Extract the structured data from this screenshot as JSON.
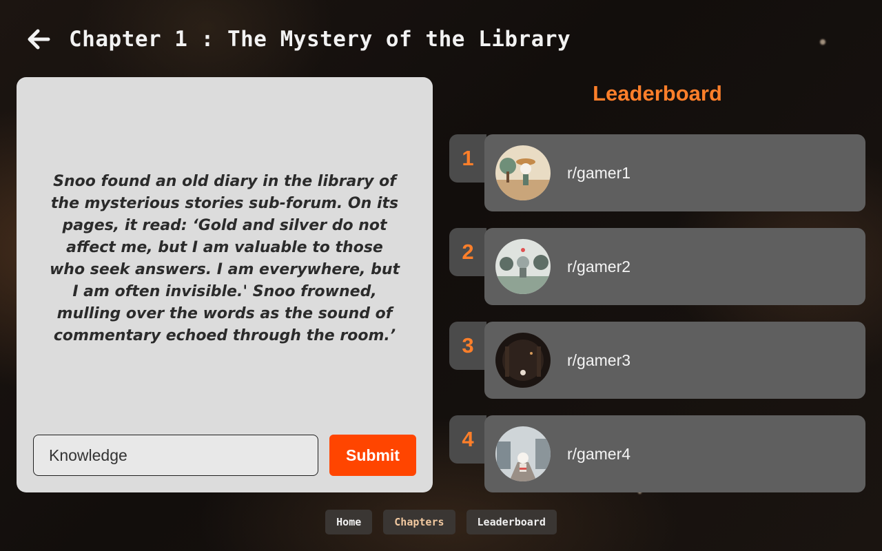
{
  "header": {
    "title": "Chapter 1 : The Mystery of the Library",
    "back_icon": "arrow-left-icon"
  },
  "story": {
    "text": "Snoo found an old diary in the library of the mysterious stories sub-forum. On its pages, it read: ‘Gold and silver do not affect me, but I am valuable to those who seek answers. I am everywhere, but I am often invisible.' Snoo frowned, mulling over the words as the sound of commentary echoed through the room.’",
    "answer_value": "Knowledge",
    "submit_label": "Submit"
  },
  "leaderboard": {
    "title": "Leaderboard",
    "entries": [
      {
        "rank": "1",
        "name": "r/gamer1"
      },
      {
        "rank": "2",
        "name": "r/gamer2"
      },
      {
        "rank": "3",
        "name": "r/gamer3"
      },
      {
        "rank": "4",
        "name": "r/gamer4"
      }
    ]
  },
  "nav": {
    "home": "Home",
    "chapters": "Chapters",
    "leaderboard": "Leaderboard"
  },
  "colors": {
    "accent": "#ff7f2a",
    "submit": "#ff4500",
    "card": "#dcdcdc",
    "row": "#5f5f5f"
  }
}
